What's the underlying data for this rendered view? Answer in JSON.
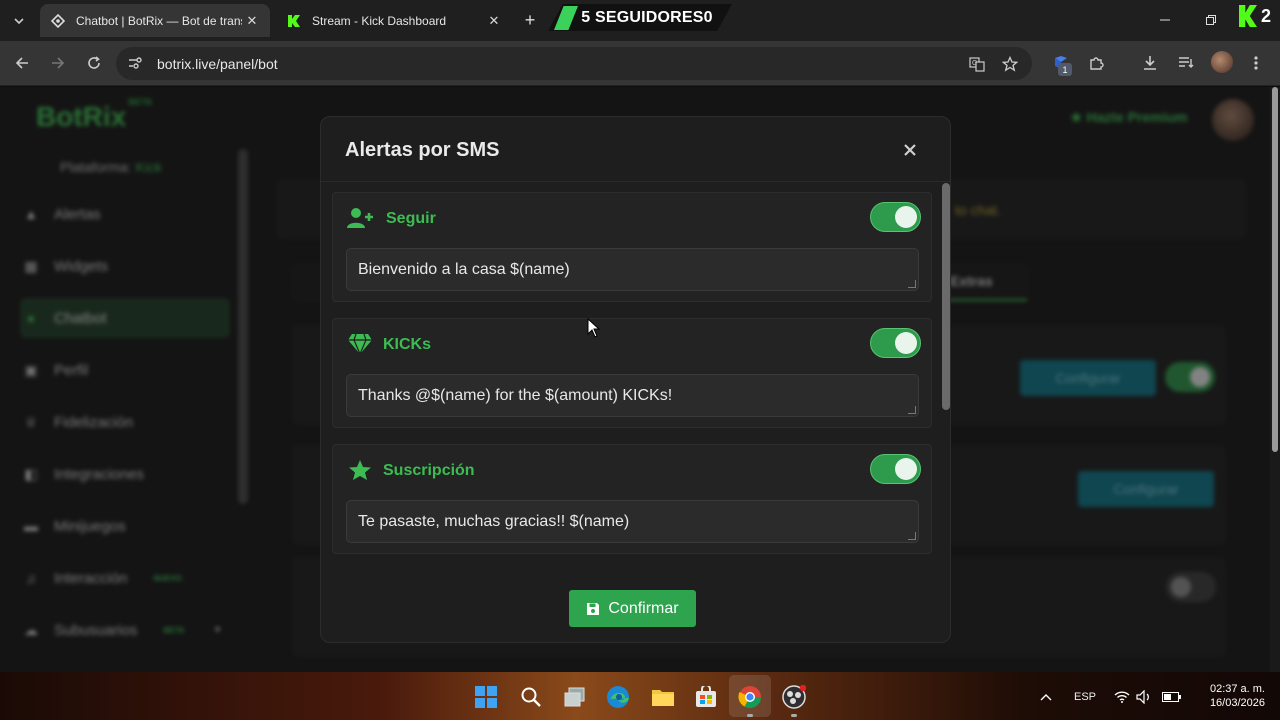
{
  "browser": {
    "tabs": [
      {
        "title": "Chatbot | BotRix — Bot de transmisión",
        "active": true,
        "icon": "botrix-tab-icon"
      },
      {
        "title": "Stream - Kick Dashboard",
        "active": false,
        "icon": "kick-tab-icon"
      }
    ],
    "overlay_banner": "5 SEGUIDORES",
    "overlay_banner_count": "0",
    "kick_counter": "2",
    "url": "botrix.live/panel/bot",
    "extension_badge": "1",
    "colors": {
      "accent": "#3cbc52",
      "switch_on": "#2e9a4c",
      "confirm": "#2ea44f"
    }
  },
  "page": {
    "logo": "BotRix",
    "logo_badge": "BETA",
    "platform_label": "Plataforma:",
    "platform_value": "Kick",
    "premium": "Hazte Premium",
    "sidebar": [
      {
        "label": "Alertas",
        "icon": "warning-icon"
      },
      {
        "label": "Widgets",
        "icon": "widgets-icon"
      },
      {
        "label": "Chatbot",
        "icon": "chat-icon",
        "active": true
      },
      {
        "label": "Perfil",
        "icon": "profile-icon"
      },
      {
        "label": "Fidelización",
        "icon": "trophy-icon"
      },
      {
        "label": "Integraciones",
        "icon": "integrations-icon"
      },
      {
        "label": "Minijuegos",
        "icon": "gamepad-icon"
      },
      {
        "label": "Interacción",
        "icon": "music-icon",
        "tag": "NUEVO"
      },
      {
        "label": "Subusuarios",
        "icon": "users-icon",
        "tag": "BETA"
      }
    ],
    "notice_fragment": "to chat.",
    "tab_fragment": "Extras",
    "configure": "Configurar"
  },
  "modal": {
    "title": "Alertas por SMS",
    "alerts": [
      {
        "label": "Seguir",
        "icon": "user-plus-icon",
        "enabled": true,
        "message": "Bienvenido a la casa $(name)"
      },
      {
        "label": "KICKs",
        "icon": "diamond-icon",
        "enabled": true,
        "message": "Thanks @$(name) for the $(amount) KICKs!"
      },
      {
        "label": "Suscripción",
        "icon": "star-icon",
        "enabled": true,
        "message": "Te pasaste, muchas gracias!! $(name)"
      }
    ],
    "confirm_label": "Confirmar"
  },
  "taskbar": {
    "language": "ESP",
    "time": "02:37 a. m.",
    "date": "16/03/2026"
  }
}
